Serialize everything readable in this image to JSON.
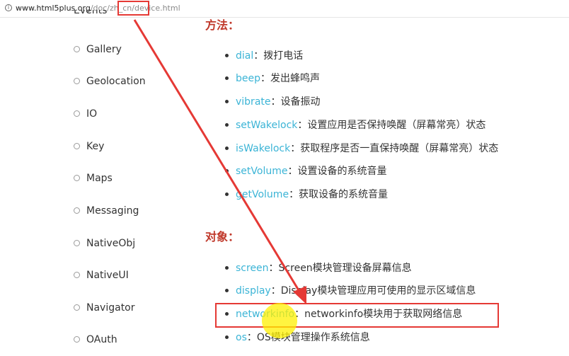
{
  "address_bar": {
    "host": "www.html5plus.org",
    "path": "/doc/zh_cn/device.html"
  },
  "sidebar": {
    "items": [
      {
        "label": "Events"
      },
      {
        "label": "Gallery"
      },
      {
        "label": "Geolocation"
      },
      {
        "label": "IO"
      },
      {
        "label": "Key"
      },
      {
        "label": "Maps"
      },
      {
        "label": "Messaging"
      },
      {
        "label": "NativeObj"
      },
      {
        "label": "NativeUI"
      },
      {
        "label": "Navigator"
      },
      {
        "label": "OAuth"
      }
    ]
  },
  "methods": {
    "title": "方法：",
    "items": [
      {
        "name": "dial",
        "desc": "：拨打电话"
      },
      {
        "name": "beep",
        "desc": "：发出蜂鸣声"
      },
      {
        "name": "vibrate",
        "desc": "：设备振动"
      },
      {
        "name": "setWakelock",
        "desc": "：设置应用是否保持唤醒（屏幕常亮）状态"
      },
      {
        "name": "isWakelock",
        "desc": "：获取程序是否一直保持唤醒（屏幕常亮）状态"
      },
      {
        "name": "setVolume",
        "desc": "：设置设备的系统音量"
      },
      {
        "name": "getVolume",
        "desc": "：获取设备的系统音量"
      }
    ]
  },
  "objects": {
    "title": "对象：",
    "items": [
      {
        "name": "screen",
        "desc": "：Screen模块管理设备屏幕信息"
      },
      {
        "name": "display",
        "desc": "：Display模块管理应用可使用的显示区域信息"
      },
      {
        "name": "networkinfo",
        "desc": "：networkinfo模块用于获取网络信息"
      },
      {
        "name": "os",
        "desc": "：OS模块管理操作系统信息"
      }
    ]
  },
  "colors": {
    "link": "#3bb4d6",
    "heading": "#c0392b",
    "annotation": "#e53935",
    "cursor": "#fff000"
  }
}
